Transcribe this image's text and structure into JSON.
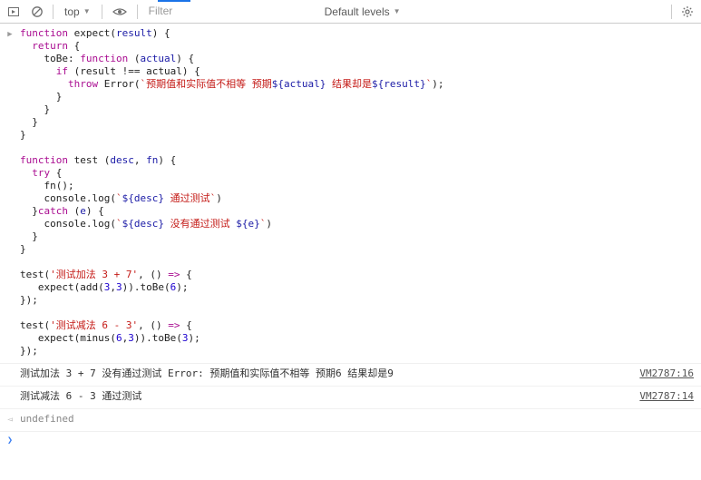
{
  "toolbar": {
    "context": "top",
    "filter_placeholder": "Filter",
    "levels_label": "Default levels",
    "levels_caret": "▼"
  },
  "code": {
    "tokens": [
      [
        [
          "kw",
          "function"
        ],
        [
          "pn",
          " "
        ],
        [
          "ident",
          "expect"
        ],
        [
          "pn",
          "("
        ],
        [
          "result-ident",
          "result"
        ],
        [
          "pn",
          ") {"
        ]
      ],
      [
        [
          "pn",
          "  "
        ],
        [
          "kw",
          "return"
        ],
        [
          "pn",
          " {"
        ]
      ],
      [
        [
          "pn",
          "    "
        ],
        [
          "ident",
          "toBe"
        ],
        [
          "pn",
          ": "
        ],
        [
          "kw",
          "function"
        ],
        [
          "pn",
          " ("
        ],
        [
          "result-ident",
          "actual"
        ],
        [
          "pn",
          ") {"
        ]
      ],
      [
        [
          "pn",
          "      "
        ],
        [
          "kw",
          "if"
        ],
        [
          "pn",
          " ("
        ],
        [
          "ident",
          "result"
        ],
        [
          "pn",
          " !== "
        ],
        [
          "ident",
          "actual"
        ],
        [
          "pn",
          ") {"
        ]
      ],
      [
        [
          "pn",
          "        "
        ],
        [
          "kw",
          "throw"
        ],
        [
          "pn",
          " "
        ],
        [
          "ident",
          "Error"
        ],
        [
          "pn",
          "("
        ],
        [
          "tmpl",
          "`预期值和实际值不相等 预期"
        ],
        [
          "interp",
          "${"
        ],
        [
          "result-ident",
          "actual"
        ],
        [
          "interp",
          "}"
        ],
        [
          "tmpl",
          " 结果却是"
        ],
        [
          "interp",
          "${"
        ],
        [
          "result-ident",
          "result"
        ],
        [
          "interp",
          "}"
        ],
        [
          "tmpl",
          "`"
        ],
        [
          "pn",
          ");"
        ]
      ],
      [
        [
          "pn",
          "      }"
        ]
      ],
      [
        [
          "pn",
          "    }"
        ]
      ],
      [
        [
          "pn",
          "  }"
        ]
      ],
      [
        [
          "pn",
          "}"
        ]
      ],
      [
        [
          "pn",
          ""
        ]
      ],
      [
        [
          "kw",
          "function"
        ],
        [
          "pn",
          " "
        ],
        [
          "ident",
          "test"
        ],
        [
          "pn",
          " ("
        ],
        [
          "result-ident",
          "desc"
        ],
        [
          "pn",
          ", "
        ],
        [
          "result-ident",
          "fn"
        ],
        [
          "pn",
          ") {"
        ]
      ],
      [
        [
          "pn",
          "  "
        ],
        [
          "kw",
          "try"
        ],
        [
          "pn",
          " {"
        ]
      ],
      [
        [
          "pn",
          "    "
        ],
        [
          "ident",
          "fn"
        ],
        [
          "pn",
          "();"
        ]
      ],
      [
        [
          "pn",
          "    "
        ],
        [
          "ident",
          "console"
        ],
        [
          "pn",
          "."
        ],
        [
          "ident",
          "log"
        ],
        [
          "pn",
          "("
        ],
        [
          "tmpl",
          "`"
        ],
        [
          "interp",
          "${"
        ],
        [
          "result-ident",
          "desc"
        ],
        [
          "interp",
          "}"
        ],
        [
          "tmpl",
          " 通过测试`"
        ],
        [
          "pn",
          ")"
        ]
      ],
      [
        [
          "pn",
          "  }"
        ],
        [
          "kw",
          "catch"
        ],
        [
          "pn",
          " ("
        ],
        [
          "result-ident",
          "e"
        ],
        [
          "pn",
          ") {"
        ]
      ],
      [
        [
          "pn",
          "    "
        ],
        [
          "ident",
          "console"
        ],
        [
          "pn",
          "."
        ],
        [
          "ident",
          "log"
        ],
        [
          "pn",
          "("
        ],
        [
          "tmpl",
          "`"
        ],
        [
          "interp",
          "${"
        ],
        [
          "result-ident",
          "desc"
        ],
        [
          "interp",
          "}"
        ],
        [
          "tmpl",
          " 没有通过测试 "
        ],
        [
          "interp",
          "${"
        ],
        [
          "result-ident",
          "e"
        ],
        [
          "interp",
          "}"
        ],
        [
          "tmpl",
          "`"
        ],
        [
          "pn",
          ")"
        ]
      ],
      [
        [
          "pn",
          "  }"
        ]
      ],
      [
        [
          "pn",
          "}"
        ]
      ],
      [
        [
          "pn",
          ""
        ]
      ],
      [
        [
          "ident",
          "test"
        ],
        [
          "pn",
          "("
        ],
        [
          "str",
          "'测试加法 3 + 7'"
        ],
        [
          "pn",
          ", () "
        ],
        [
          "kw",
          "=>"
        ],
        [
          "pn",
          " {"
        ]
      ],
      [
        [
          "pn",
          "   "
        ],
        [
          "ident",
          "expect"
        ],
        [
          "pn",
          "("
        ],
        [
          "ident",
          "add"
        ],
        [
          "pn",
          "("
        ],
        [
          "num",
          "3"
        ],
        [
          "pn",
          ","
        ],
        [
          "num",
          "3"
        ],
        [
          "pn",
          "))."
        ],
        [
          "ident",
          "toBe"
        ],
        [
          "pn",
          "("
        ],
        [
          "num",
          "6"
        ],
        [
          "pn",
          ");"
        ]
      ],
      [
        [
          "pn",
          "});"
        ]
      ],
      [
        [
          "pn",
          ""
        ]
      ],
      [
        [
          "ident",
          "test"
        ],
        [
          "pn",
          "("
        ],
        [
          "str",
          "'测试减法 6 - 3'"
        ],
        [
          "pn",
          ", () "
        ],
        [
          "kw",
          "=>"
        ],
        [
          "pn",
          " {"
        ]
      ],
      [
        [
          "pn",
          "   "
        ],
        [
          "ident",
          "expect"
        ],
        [
          "pn",
          "("
        ],
        [
          "ident",
          "minus"
        ],
        [
          "pn",
          "("
        ],
        [
          "num",
          "6"
        ],
        [
          "pn",
          ","
        ],
        [
          "num",
          "3"
        ],
        [
          "pn",
          "))."
        ],
        [
          "ident",
          "toBe"
        ],
        [
          "pn",
          "("
        ],
        [
          "num",
          "3"
        ],
        [
          "pn",
          ");"
        ]
      ],
      [
        [
          "pn",
          "});"
        ]
      ]
    ]
  },
  "logs": [
    {
      "text": "测试加法 3 + 7 没有通过测试 Error: 预期值和实际值不相等 预期6 结果却是9",
      "source": "VM2787:16"
    },
    {
      "text": "测试减法 6 - 3 通过测试",
      "source": "VM2787:14"
    }
  ],
  "return_row": {
    "value": "undefined"
  }
}
